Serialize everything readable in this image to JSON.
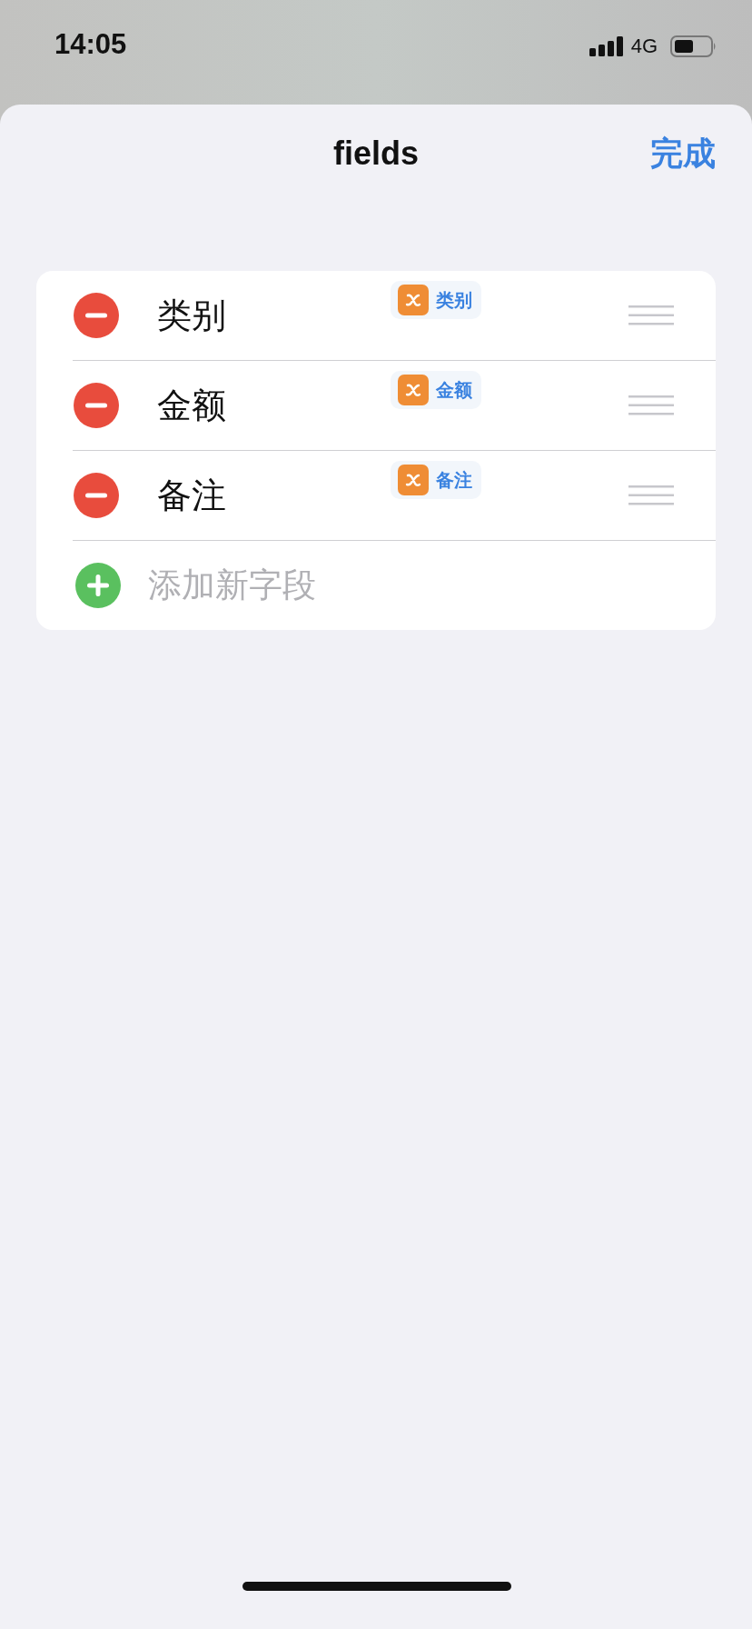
{
  "status_bar": {
    "time": "14:05",
    "network": "4G"
  },
  "sheet": {
    "title": "fields",
    "done_button": "完成"
  },
  "fields": [
    {
      "name": "类别",
      "variable": "类别"
    },
    {
      "name": "金额",
      "variable": "金额"
    },
    {
      "name": "备注",
      "variable": "备注"
    }
  ],
  "add_field": {
    "label": "添加新字段"
  }
}
